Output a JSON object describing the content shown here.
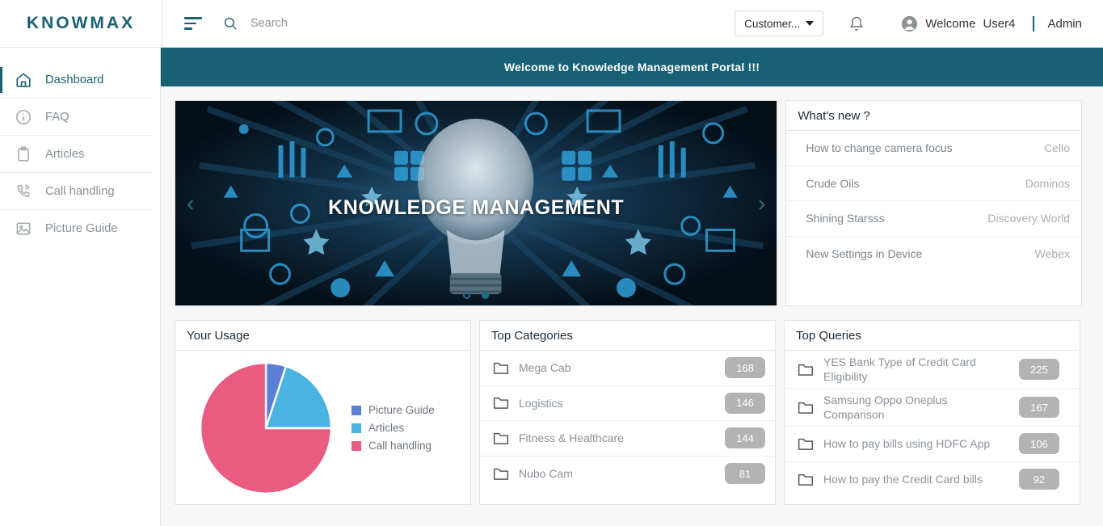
{
  "app": {
    "brand": "KNOWMAX",
    "accent": "#1a6073",
    "banner_bg": "#186074"
  },
  "topbar": {
    "search_placeholder": "Search",
    "customer_select_label": "Customer...",
    "welcome_text": "Welcome",
    "user_name": "User4",
    "admin_label": "Admin",
    "icons": {
      "hamburger": "menu-icon",
      "search": "search-icon",
      "bell": "notification-bell-icon",
      "avatar": "user-avatar-icon",
      "caret": "chevron-down-icon"
    }
  },
  "sidebar": {
    "items": [
      {
        "label": "Dashboard",
        "icon": "home-icon",
        "active": true
      },
      {
        "label": "FAQ",
        "icon": "info-circle-icon",
        "active": false
      },
      {
        "label": "Articles",
        "icon": "clipboard-icon",
        "active": false
      },
      {
        "label": "Call handling",
        "icon": "phone-call-icon",
        "active": false
      },
      {
        "label": "Picture Guide",
        "icon": "image-icon",
        "active": false
      }
    ]
  },
  "banner": {
    "text": "Welcome to Knowledge Management Portal !!!"
  },
  "hero": {
    "title": "KNOWLEDGE MANAGEMENT",
    "prev_arrow": "‹",
    "next_arrow": "›",
    "dots": 2,
    "active_dot": 1
  },
  "whats_new": {
    "title": "What's new ?",
    "rows": [
      {
        "title": "How to change camera focus",
        "source": "Cello"
      },
      {
        "title": "Crude Oils",
        "source": "Dominos"
      },
      {
        "title": "Shining Starsss",
        "source": "Discovery World"
      },
      {
        "title": "New Settings in Device",
        "source": "Webex"
      }
    ]
  },
  "your_usage": {
    "title": "Your Usage"
  },
  "chart_data": {
    "type": "pie",
    "title": "Your Usage",
    "categories": [
      "Picture Guide",
      "Articles",
      "Call handling"
    ],
    "values": [
      5,
      20,
      75
    ],
    "colors": [
      "#5b7fd4",
      "#4ab3e3",
      "#ea5b82"
    ],
    "legend_position": "right",
    "xlabel": "",
    "ylabel": ""
  },
  "top_categories": {
    "title": "Top Categories",
    "rows": [
      {
        "label": "Mega Cab",
        "count": "168"
      },
      {
        "label": "Logistics",
        "count": "146"
      },
      {
        "label": "Fitness & Healthcare",
        "count": "144"
      },
      {
        "label": "Nubo Cam",
        "count": "81"
      }
    ]
  },
  "top_queries": {
    "title": "Top Queries",
    "rows": [
      {
        "label": "YES Bank Type of Credit Card Eligibility",
        "count": "225"
      },
      {
        "label": "Samsung Oppo Oneplus Comparison",
        "count": "167"
      },
      {
        "label": "How to pay bills using HDFC App",
        "count": "106"
      },
      {
        "label": "How to pay the Credit Card bills",
        "count": "92"
      }
    ]
  }
}
